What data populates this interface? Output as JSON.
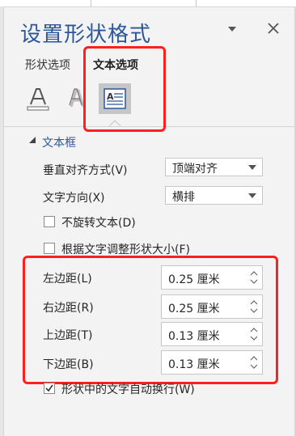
{
  "pane": {
    "title": "设置形状格式",
    "tabs": [
      {
        "label": "形状选项",
        "active": false
      },
      {
        "label": "文本选项",
        "active": true
      }
    ]
  },
  "icons": {
    "fill": "text-fill-outline-icon",
    "effects": "text-effects-icon",
    "textbox": "textbox-icon",
    "dropdown": "chevron-down-icon",
    "close": "close-icon"
  },
  "section": {
    "title": "文本框",
    "expanded": true
  },
  "fields": {
    "vertical_align": {
      "label": "垂直对齐方式(V)",
      "value": "顶端对齐"
    },
    "text_direction": {
      "label": "文字方向(X)",
      "value": "横排"
    },
    "no_rotate": {
      "label": "不旋转文本(D)",
      "checked": false
    },
    "resize_shape": {
      "label": "根据文字调整形状大小(F)",
      "checked": false
    },
    "left_margin": {
      "label": "左边距(L)",
      "value": "0.25 厘米"
    },
    "right_margin": {
      "label": "右边距(R)",
      "value": "0.25 厘米"
    },
    "top_margin": {
      "label": "上边距(T)",
      "value": "0.13 厘米"
    },
    "bottom_margin": {
      "label": "下边距(B)",
      "value": "0.13 厘米"
    },
    "wrap_text": {
      "label": "形状中的文字自动换行(W)",
      "checked": true
    }
  },
  "colors": {
    "accent": "#2b579a",
    "highlight": "#ff1f1f",
    "pane_bg": "#f3f3f3"
  }
}
